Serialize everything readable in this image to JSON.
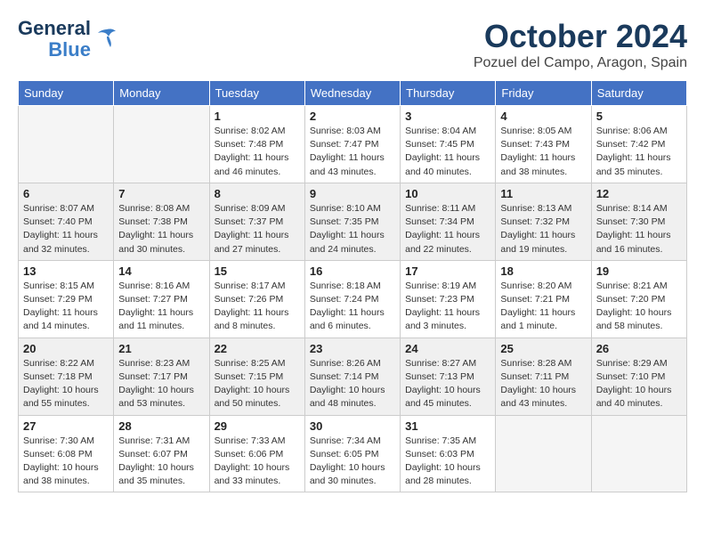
{
  "header": {
    "logo_line1": "General",
    "logo_line2": "Blue",
    "month": "October 2024",
    "location": "Pozuel del Campo, Aragon, Spain"
  },
  "weekdays": [
    "Sunday",
    "Monday",
    "Tuesday",
    "Wednesday",
    "Thursday",
    "Friday",
    "Saturday"
  ],
  "weeks": [
    [
      {
        "day": "",
        "info": ""
      },
      {
        "day": "",
        "info": ""
      },
      {
        "day": "1",
        "info": "Sunrise: 8:02 AM\nSunset: 7:48 PM\nDaylight: 11 hours and 46 minutes."
      },
      {
        "day": "2",
        "info": "Sunrise: 8:03 AM\nSunset: 7:47 PM\nDaylight: 11 hours and 43 minutes."
      },
      {
        "day": "3",
        "info": "Sunrise: 8:04 AM\nSunset: 7:45 PM\nDaylight: 11 hours and 40 minutes."
      },
      {
        "day": "4",
        "info": "Sunrise: 8:05 AM\nSunset: 7:43 PM\nDaylight: 11 hours and 38 minutes."
      },
      {
        "day": "5",
        "info": "Sunrise: 8:06 AM\nSunset: 7:42 PM\nDaylight: 11 hours and 35 minutes."
      }
    ],
    [
      {
        "day": "6",
        "info": "Sunrise: 8:07 AM\nSunset: 7:40 PM\nDaylight: 11 hours and 32 minutes."
      },
      {
        "day": "7",
        "info": "Sunrise: 8:08 AM\nSunset: 7:38 PM\nDaylight: 11 hours and 30 minutes."
      },
      {
        "day": "8",
        "info": "Sunrise: 8:09 AM\nSunset: 7:37 PM\nDaylight: 11 hours and 27 minutes."
      },
      {
        "day": "9",
        "info": "Sunrise: 8:10 AM\nSunset: 7:35 PM\nDaylight: 11 hours and 24 minutes."
      },
      {
        "day": "10",
        "info": "Sunrise: 8:11 AM\nSunset: 7:34 PM\nDaylight: 11 hours and 22 minutes."
      },
      {
        "day": "11",
        "info": "Sunrise: 8:13 AM\nSunset: 7:32 PM\nDaylight: 11 hours and 19 minutes."
      },
      {
        "day": "12",
        "info": "Sunrise: 8:14 AM\nSunset: 7:30 PM\nDaylight: 11 hours and 16 minutes."
      }
    ],
    [
      {
        "day": "13",
        "info": "Sunrise: 8:15 AM\nSunset: 7:29 PM\nDaylight: 11 hours and 14 minutes."
      },
      {
        "day": "14",
        "info": "Sunrise: 8:16 AM\nSunset: 7:27 PM\nDaylight: 11 hours and 11 minutes."
      },
      {
        "day": "15",
        "info": "Sunrise: 8:17 AM\nSunset: 7:26 PM\nDaylight: 11 hours and 8 minutes."
      },
      {
        "day": "16",
        "info": "Sunrise: 8:18 AM\nSunset: 7:24 PM\nDaylight: 11 hours and 6 minutes."
      },
      {
        "day": "17",
        "info": "Sunrise: 8:19 AM\nSunset: 7:23 PM\nDaylight: 11 hours and 3 minutes."
      },
      {
        "day": "18",
        "info": "Sunrise: 8:20 AM\nSunset: 7:21 PM\nDaylight: 11 hours and 1 minute."
      },
      {
        "day": "19",
        "info": "Sunrise: 8:21 AM\nSunset: 7:20 PM\nDaylight: 10 hours and 58 minutes."
      }
    ],
    [
      {
        "day": "20",
        "info": "Sunrise: 8:22 AM\nSunset: 7:18 PM\nDaylight: 10 hours and 55 minutes."
      },
      {
        "day": "21",
        "info": "Sunrise: 8:23 AM\nSunset: 7:17 PM\nDaylight: 10 hours and 53 minutes."
      },
      {
        "day": "22",
        "info": "Sunrise: 8:25 AM\nSunset: 7:15 PM\nDaylight: 10 hours and 50 minutes."
      },
      {
        "day": "23",
        "info": "Sunrise: 8:26 AM\nSunset: 7:14 PM\nDaylight: 10 hours and 48 minutes."
      },
      {
        "day": "24",
        "info": "Sunrise: 8:27 AM\nSunset: 7:13 PM\nDaylight: 10 hours and 45 minutes."
      },
      {
        "day": "25",
        "info": "Sunrise: 8:28 AM\nSunset: 7:11 PM\nDaylight: 10 hours and 43 minutes."
      },
      {
        "day": "26",
        "info": "Sunrise: 8:29 AM\nSunset: 7:10 PM\nDaylight: 10 hours and 40 minutes."
      }
    ],
    [
      {
        "day": "27",
        "info": "Sunrise: 7:30 AM\nSunset: 6:08 PM\nDaylight: 10 hours and 38 minutes."
      },
      {
        "day": "28",
        "info": "Sunrise: 7:31 AM\nSunset: 6:07 PM\nDaylight: 10 hours and 35 minutes."
      },
      {
        "day": "29",
        "info": "Sunrise: 7:33 AM\nSunset: 6:06 PM\nDaylight: 10 hours and 33 minutes."
      },
      {
        "day": "30",
        "info": "Sunrise: 7:34 AM\nSunset: 6:05 PM\nDaylight: 10 hours and 30 minutes."
      },
      {
        "day": "31",
        "info": "Sunrise: 7:35 AM\nSunset: 6:03 PM\nDaylight: 10 hours and 28 minutes."
      },
      {
        "day": "",
        "info": ""
      },
      {
        "day": "",
        "info": ""
      }
    ]
  ]
}
